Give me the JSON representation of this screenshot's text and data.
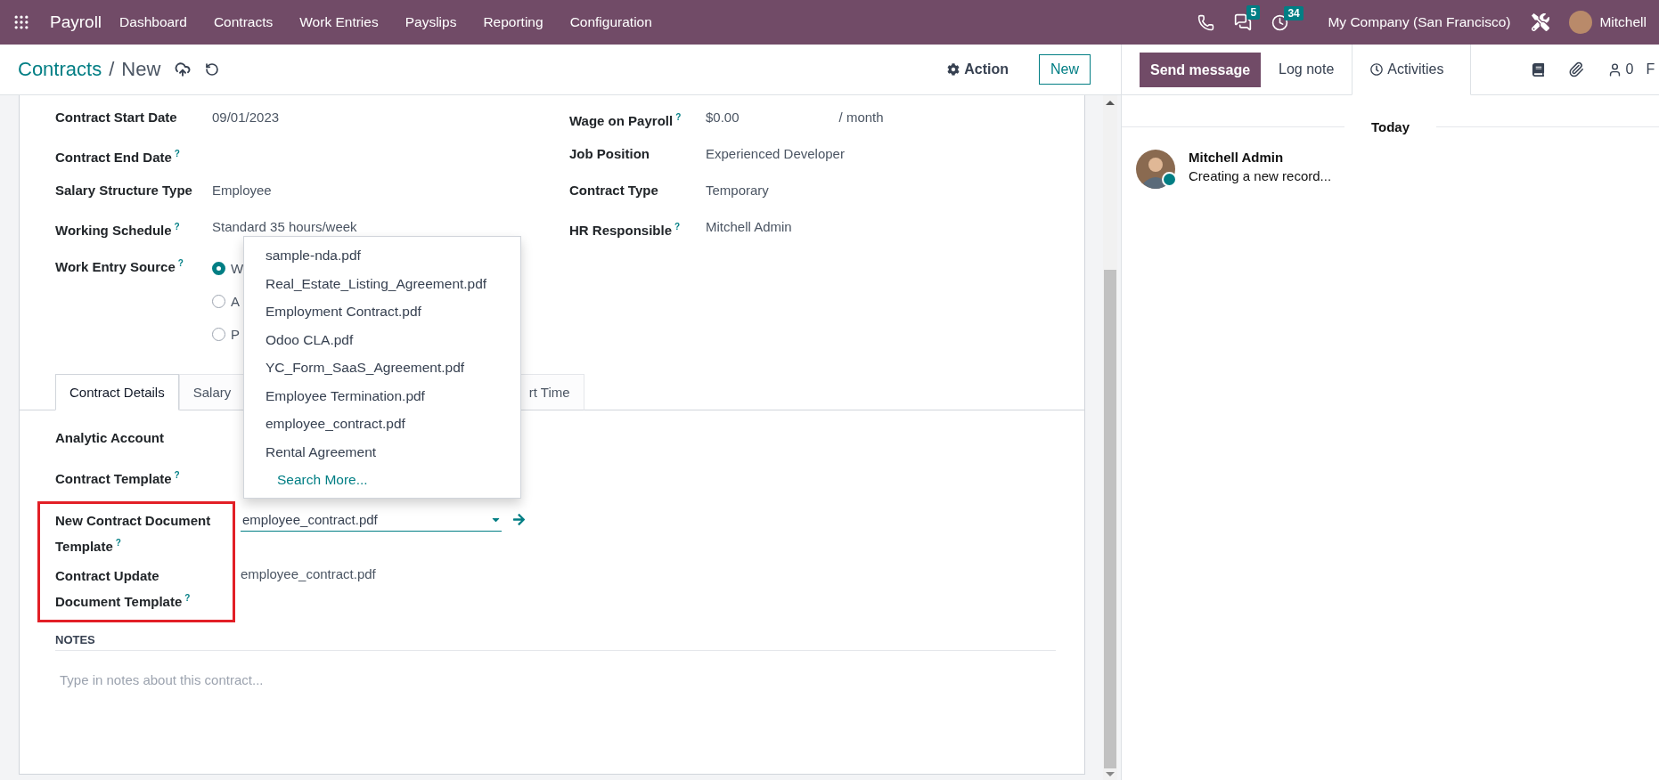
{
  "navbar": {
    "app": "Payroll",
    "menu": [
      "Dashboard",
      "Contracts",
      "Work Entries",
      "Payslips",
      "Reporting",
      "Configuration"
    ],
    "messages_count": "5",
    "activities_count": "34",
    "company": "My Company (San Francisco)",
    "user": "Mitchell"
  },
  "control_panel": {
    "breadcrumb": "Contracts",
    "separator": "/",
    "current": "New",
    "action": "Action",
    "new_button": "New"
  },
  "left_fields": [
    {
      "label": "Contract Start Date",
      "value": "09/01/2023"
    },
    {
      "label": "Contract End Date",
      "help": "?"
    },
    {
      "label": "Salary Structure Type",
      "value": "Employee"
    },
    {
      "label": "Working Schedule",
      "help": "?",
      "value": "Standard 35 hours/week"
    }
  ],
  "work_entry_source": {
    "label": "Work Entry Source",
    "help": "?",
    "options": [
      {
        "label": "W",
        "selected": true
      },
      {
        "label": "A",
        "selected": false
      },
      {
        "label": "P",
        "selected": false
      }
    ]
  },
  "right_fields": [
    {
      "label": "Wage on Payroll",
      "help": "?",
      "value": "$0.00",
      "suffix": "/ month"
    },
    {
      "label": "Job Position",
      "value": "Experienced Developer"
    },
    {
      "label": "Contract Type",
      "value": "Temporary"
    },
    {
      "label": "HR Responsible",
      "help": "?",
      "value": "Mitchell Admin"
    }
  ],
  "tabs": [
    {
      "label": "Contract Details",
      "selected": true
    },
    {
      "label": "Salary",
      "selected": false
    },
    {
      "label": "rt Time",
      "selected": false
    }
  ],
  "detail_fields": [
    {
      "label": "Analytic Account"
    },
    {
      "label": "Contract Template",
      "help": "?"
    }
  ],
  "highlighted_fields": [
    {
      "label": "New Contract Document Template",
      "help": "?",
      "value": "employee_contract.pdf",
      "kind": "dropdown"
    },
    {
      "label": "Contract Update Document Template",
      "help": "?",
      "value": "employee_contract.pdf",
      "kind": "text"
    }
  ],
  "dropdown": {
    "items": [
      "sample-nda.pdf",
      "Real_Estate_Listing_Agreement.pdf",
      "Employment Contract.pdf",
      "Odoo CLA.pdf",
      "YC_Form_SaaS_Agreement.pdf",
      "Employee Termination.pdf",
      "employee_contract.pdf",
      "Rental Agreement"
    ],
    "search_more": "Search More..."
  },
  "notes": {
    "heading": "NOTES",
    "placeholder": "Type in notes about this contract..."
  },
  "chatter": {
    "send_message": "Send message",
    "log_note": "Log note",
    "activities": "Activities",
    "followers_count": "0",
    "follow": "F",
    "date_separator": "Today",
    "messages": [
      {
        "author": "Mitchell Admin",
        "body": "Creating a new record...",
        "online": true
      }
    ]
  }
}
